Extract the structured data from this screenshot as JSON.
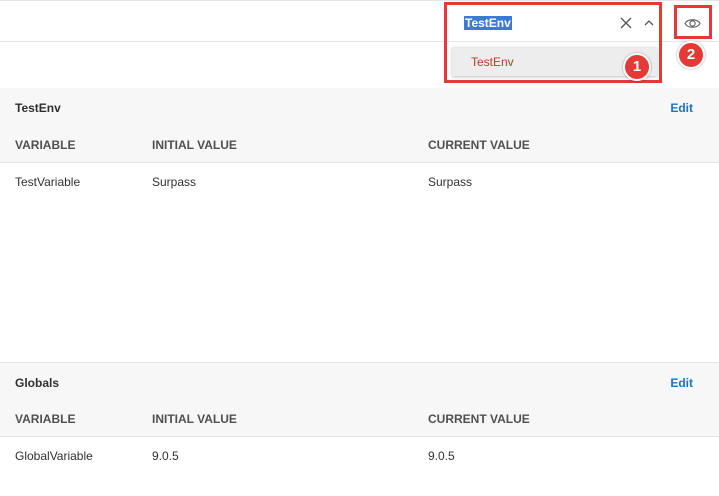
{
  "environment_selector": {
    "selected_value": "TestEnv",
    "dropdown_options": [
      "TestEnv"
    ]
  },
  "annotations": [
    "1",
    "2"
  ],
  "sections": [
    {
      "name": "TestEnv",
      "edit_label": "Edit",
      "columns": [
        "VARIABLE",
        "INITIAL VALUE",
        "CURRENT VALUE"
      ],
      "rows": [
        {
          "variable": "TestVariable",
          "initial_value": "Surpass",
          "current_value": "Surpass"
        }
      ]
    },
    {
      "name": "Globals",
      "edit_label": "Edit",
      "columns": [
        "VARIABLE",
        "INITIAL VALUE",
        "CURRENT VALUE"
      ],
      "rows": [
        {
          "variable": "GlobalVariable",
          "initial_value": "9.0.5",
          "current_value": "9.0.5"
        }
      ]
    }
  ],
  "colors": {
    "accent_link": "#1a73c8",
    "callout": "#e53935",
    "selected_text_highlight": "#3a7bd5",
    "dropdown_item_text": "#c0392b"
  },
  "icons": {
    "clear": "close-icon",
    "collapse": "chevron-up-icon",
    "quick_look": "eye-icon"
  }
}
